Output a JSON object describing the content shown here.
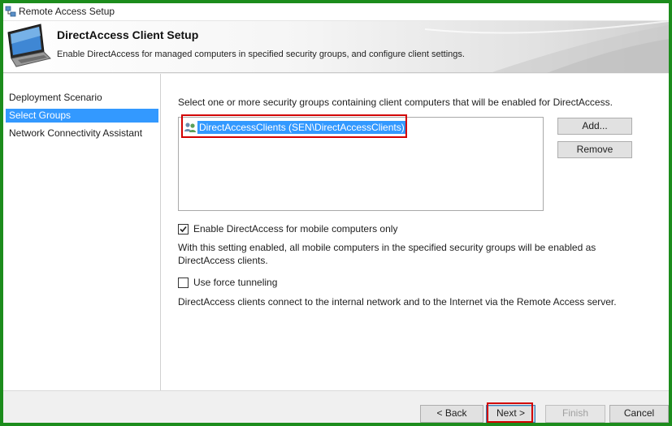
{
  "window": {
    "title": "Remote Access Setup"
  },
  "header": {
    "title": "DirectAccess Client Setup",
    "subtitle": "Enable DirectAccess for managed computers in specified security groups, and configure client settings."
  },
  "nav": {
    "items": [
      {
        "label": "Deployment Scenario",
        "selected": false
      },
      {
        "label": "Select Groups",
        "selected": true
      },
      {
        "label": "Network Connectivity Assistant",
        "selected": false
      }
    ]
  },
  "main": {
    "instruction": "Select one or more security groups containing client computers that will be enabled for DirectAccess.",
    "groups": [
      {
        "label": "DirectAccessClients (SEN\\DirectAccessClients)",
        "selected": true
      }
    ],
    "add_label": "Add...",
    "remove_label": "Remove",
    "mobile_checkbox": {
      "label": "Enable DirectAccess for mobile computers only",
      "checked": true
    },
    "mobile_desc_line1": "With this setting enabled, all mobile computers in the specified security groups will be enabled as",
    "mobile_desc_line2": "DirectAccess clients.",
    "force_checkbox": {
      "label": "Use force tunneling",
      "checked": false
    },
    "force_desc": "DirectAccess clients connect to the internal network and to the Internet via the Remote Access server."
  },
  "footer": {
    "back_label": "< Back",
    "next_label": "Next >",
    "finish_label": "Finish",
    "cancel_label": "Cancel"
  },
  "colors": {
    "selection": "#3399ff",
    "highlight_box": "#d20000",
    "frame": "#1c8c1c"
  },
  "icons": {
    "app": "network-setup-icon",
    "header": "laptop-icon",
    "group": "user-group-icon"
  }
}
